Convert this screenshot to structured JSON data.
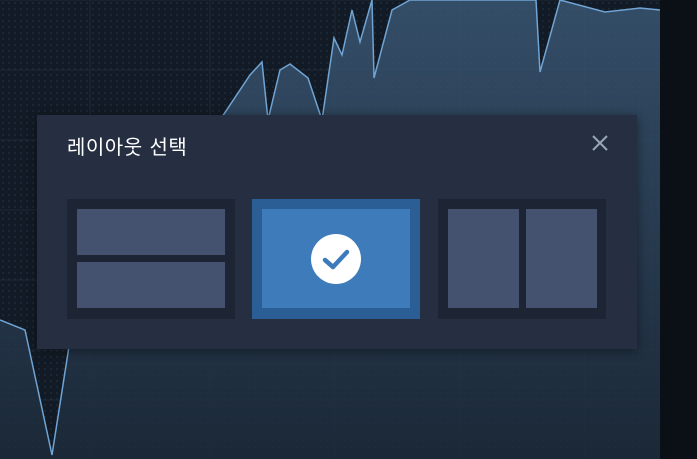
{
  "dialog": {
    "title": "레이아웃 선택",
    "close_icon": "close-icon"
  },
  "layouts": [
    {
      "id": "horizontal-split",
      "selected": false
    },
    {
      "id": "single",
      "selected": true,
      "icon": "check-icon"
    },
    {
      "id": "vertical-split",
      "selected": false
    }
  ],
  "colors": {
    "dialog_bg": "#262f42",
    "option_bg": "#1d2434",
    "pane": "#44516f",
    "selected_bg": "#2c5e96",
    "selected_pane": "#3d7bbb",
    "check_fg": "#3d7bbb"
  }
}
